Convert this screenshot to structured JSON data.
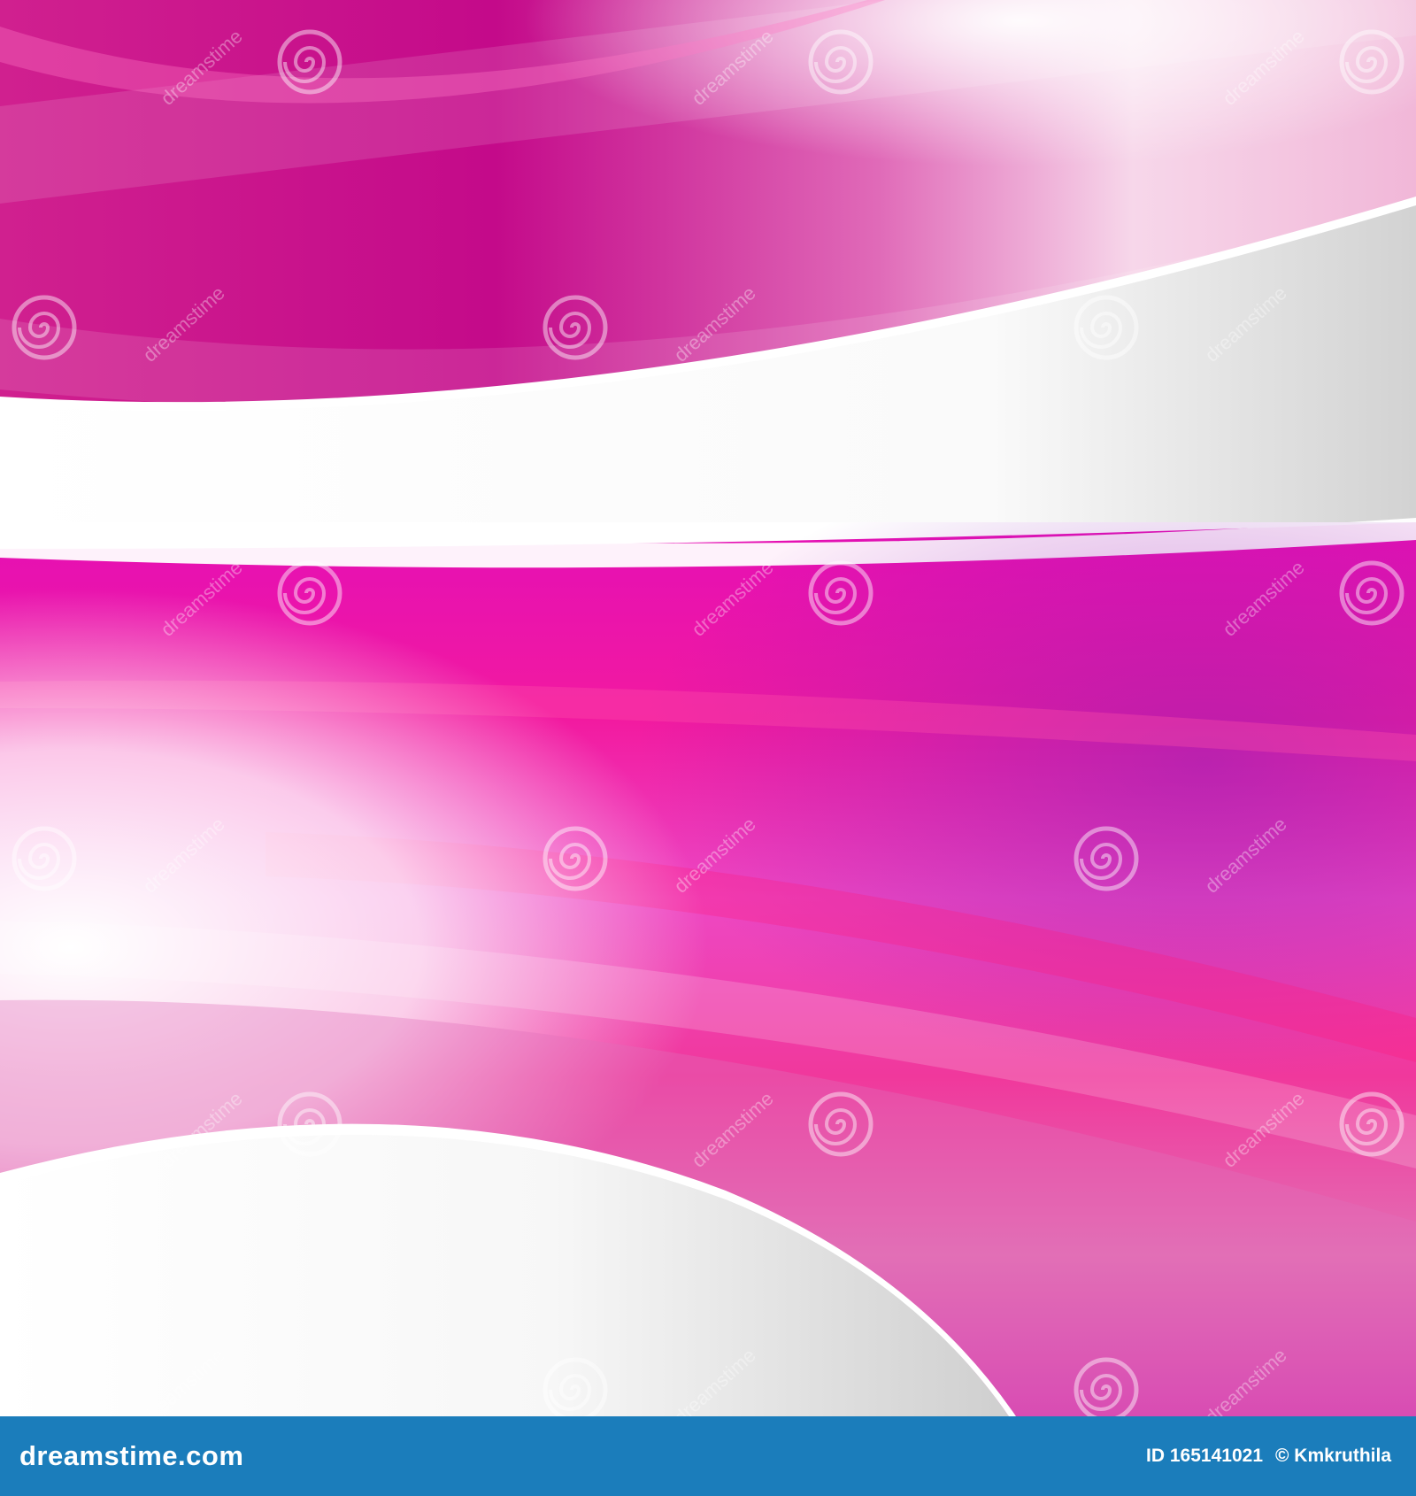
{
  "image": {
    "subject": "abstract pink and magenta wave background",
    "colors": {
      "magenta_dark": "#b6087e",
      "magenta": "#d20c98",
      "hot_pink": "#ff1a8c",
      "violet": "#b02cc0",
      "pink_light": "#f3a9d2",
      "white": "#ffffff",
      "gray_light": "#d9d9d9"
    }
  },
  "watermark": {
    "brand_text": "dreamstime",
    "icon": "spiral-icon"
  },
  "footer": {
    "brand": "dreamstime.com",
    "id_label": "ID 165141021",
    "copyright": "© Kmkruthila",
    "background": "#1b7dbb"
  }
}
